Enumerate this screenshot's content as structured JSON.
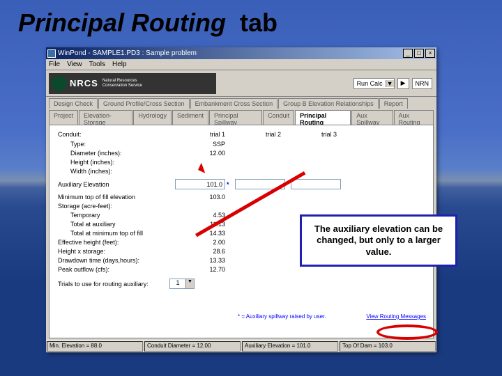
{
  "slide": {
    "title_pre": "Principal Routing",
    "title_post": "tab"
  },
  "window": {
    "title": "WinPond - SAMPLE1.PD3 : Sample problem",
    "menu": [
      "File",
      "View",
      "Tools",
      "Help"
    ],
    "logo": {
      "abbr": "NRCS",
      "sub1": "Natural Resources",
      "sub2": "Conservation Service"
    },
    "toolbar_right": {
      "run_label": "Run Calc",
      "arrow": "▼",
      "next": "▶",
      "nrn": "NRN"
    },
    "tabs1": [
      "Design Check",
      "Ground Profile/Cross Section",
      "Embankment Cross Section",
      "Group B Elevation Relationships",
      "Report"
    ],
    "tabs2": [
      "Project",
      "Elevation-Storage",
      "Hydrology",
      "Sediment",
      "Principal Spillway",
      "Conduit",
      "Principal Routing",
      "Aux Spillway",
      "Aux Routing"
    ],
    "active_tab2": "Principal Routing"
  },
  "columns": {
    "label": "Conduit:",
    "c1": "trial 1",
    "c2": "trial 2",
    "c3": "trial 3"
  },
  "rows": {
    "type": {
      "label": "Type:",
      "c1": "SSP"
    },
    "diameter": {
      "label": "Diameter (inches):",
      "c1": "12.00"
    },
    "height": {
      "label": "Height (inches):",
      "c1": ""
    },
    "width": {
      "label": "Width (inches):",
      "c1": ""
    }
  },
  "aux": {
    "label": "Auxiliary Elevation",
    "value": "101.0",
    "aster": "*"
  },
  "rows2": {
    "minfill": {
      "label": "Minimum top of fill elevation",
      "c1": "103.0"
    },
    "storage": {
      "label": "Storage (acre-feet):",
      "c1": ""
    },
    "temp": {
      "label": "Temporary",
      "c1": "4.53"
    },
    "totaux": {
      "label": "Total at auxiliary",
      "c1": "11.13"
    },
    "totfill": {
      "label": "Total at minimum top of fill",
      "c1": "14.33"
    },
    "effh": {
      "label": "Effective height (feet):",
      "c1": "2.00"
    },
    "hstor": {
      "label": "Height x storage:",
      "c1": "28.6"
    },
    "draw": {
      "label": "Drawdown time (days,hours):",
      "c1": "13.33"
    },
    "peak": {
      "label": "Peak outflow (cfs):",
      "c1": "12.70"
    }
  },
  "trials": {
    "label": "Trials to use for routing auxiliary:",
    "value": "1"
  },
  "footer": {
    "note": "* = Auxiliary spillway raised by user.",
    "link": "View Routing Messages"
  },
  "status": {
    "a": "Min. Elevation = 88.0",
    "b": "Conduit Diameter = 12.00",
    "c": "Auxiliary Elevation = 101.0",
    "d": "Top Of Dam = 103.0"
  },
  "callout": "The auxiliary elevation can be changed, but only to a larger value."
}
